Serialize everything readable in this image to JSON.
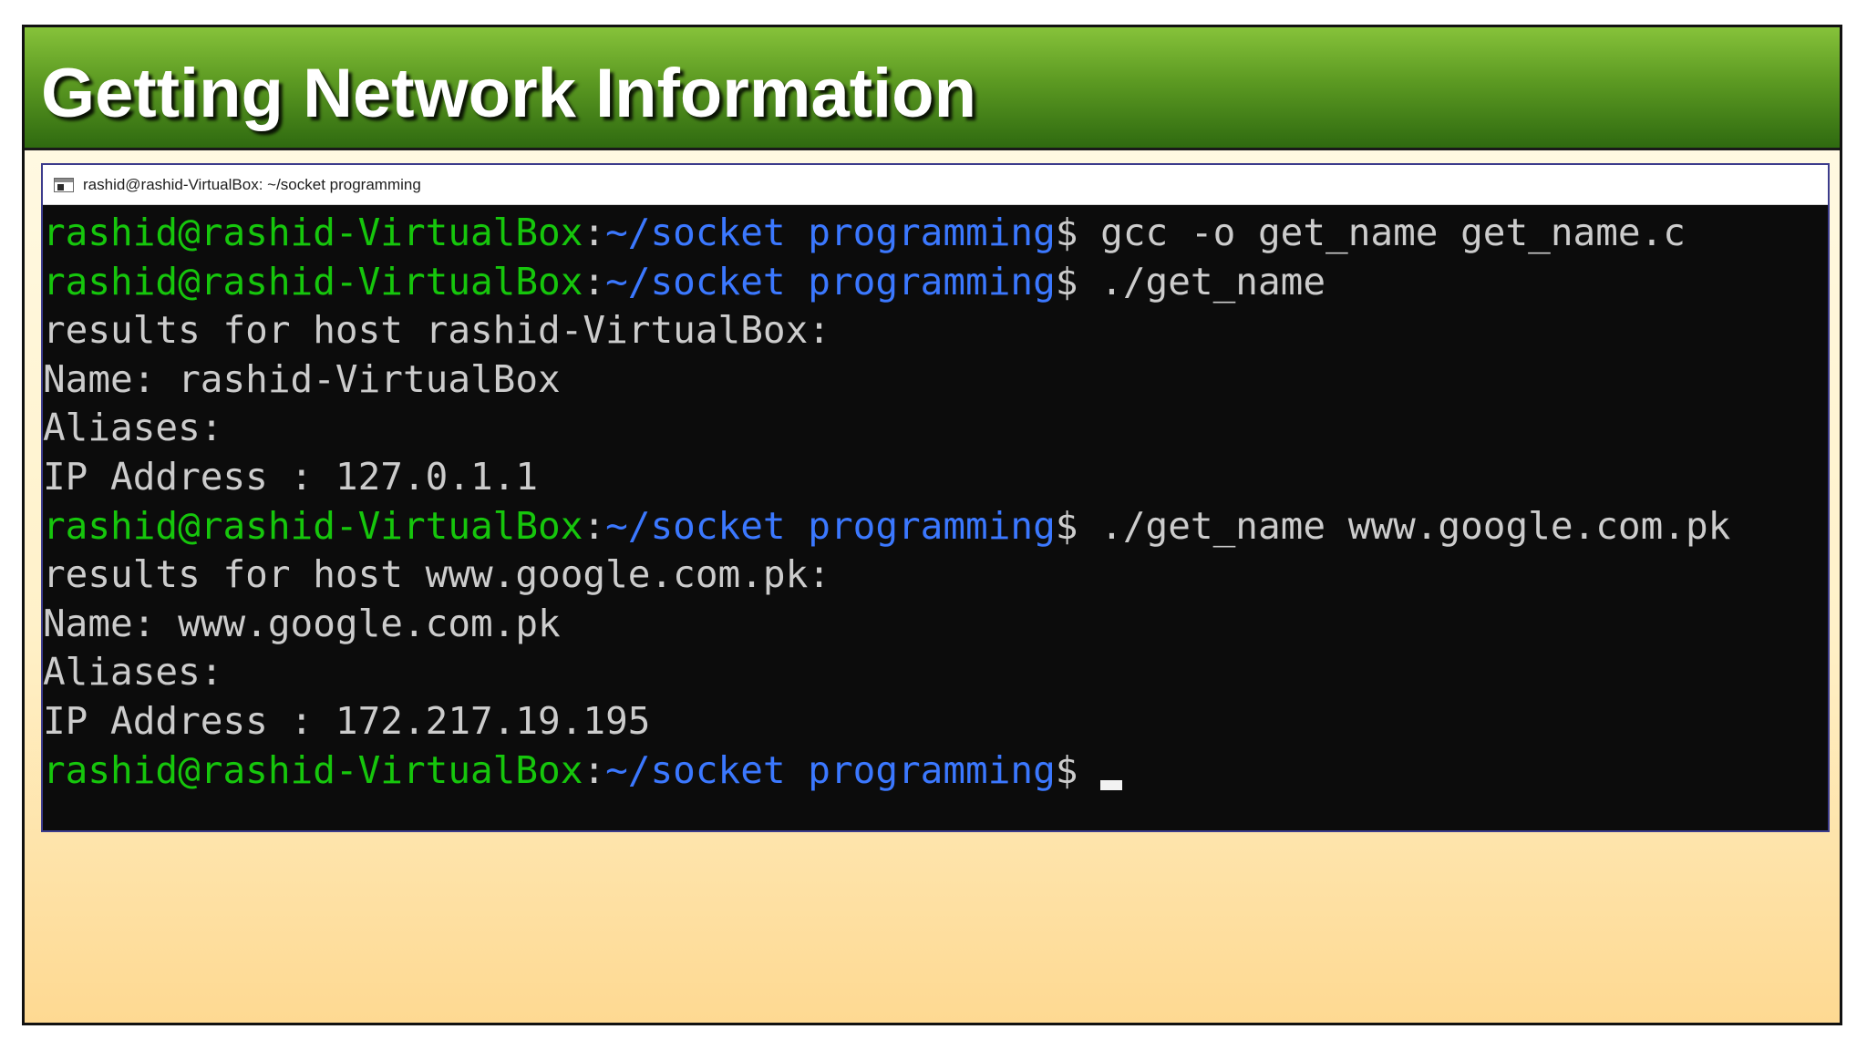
{
  "slide": {
    "title": "Getting Network Information"
  },
  "terminal": {
    "window_title": "rashid@rashid-VirtualBox: ~/socket programming",
    "prompt": {
      "user_host": "rashid@rashid-VirtualBox",
      "separator": ":",
      "path": "~/socket programming",
      "symbol": "$"
    },
    "lines": [
      {
        "type": "prompt",
        "command": "gcc -o get_name get_name.c"
      },
      {
        "type": "prompt",
        "command": "./get_name"
      },
      {
        "type": "output",
        "text": "results for host rashid-VirtualBox:"
      },
      {
        "type": "output",
        "text": "Name: rashid-VirtualBox"
      },
      {
        "type": "output",
        "text": "Aliases:"
      },
      {
        "type": "output",
        "text": "IP Address : 127.0.1.1"
      },
      {
        "type": "prompt",
        "command": "./get_name www.google.com.pk"
      },
      {
        "type": "output",
        "text": "results for host www.google.com.pk:"
      },
      {
        "type": "output",
        "text": "Name: www.google.com.pk"
      },
      {
        "type": "output",
        "text": "Aliases:"
      },
      {
        "type": "output",
        "text": "IP Address : 172.217.19.195"
      },
      {
        "type": "prompt",
        "command": "",
        "cursor": true
      }
    ],
    "colors": {
      "background": "#0c0c0c",
      "foreground": "#cccccc",
      "user_host": "#16c60c",
      "path": "#3b78ff"
    }
  }
}
